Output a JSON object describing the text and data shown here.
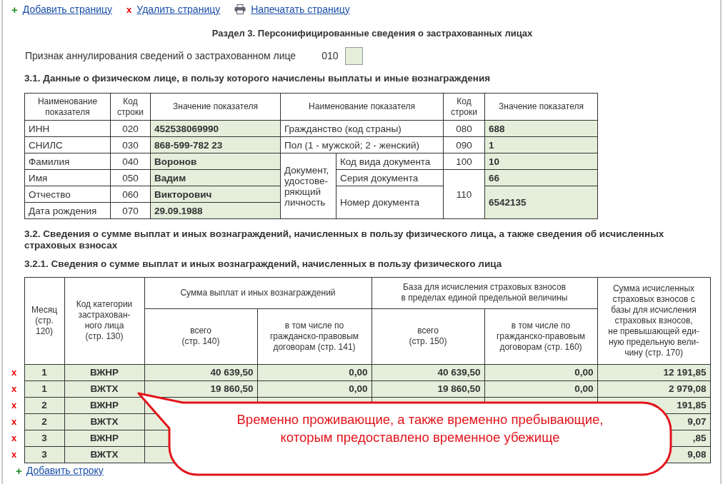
{
  "toolbar": [
    {
      "kind": "add",
      "icon": "+",
      "label": "Добавить страницу"
    },
    {
      "kind": "delete",
      "icon": "x",
      "label": "Удалить страницу"
    },
    {
      "kind": "print",
      "label": "Напечатать страницу"
    }
  ],
  "section_title": "Раздел 3. Персонифицированные сведения о застрахованных лицах",
  "cancel_flag": {
    "label": "Признак аннулирования сведений о застрахованном лице",
    "code": "010"
  },
  "subsection_1": {
    "title": "3.1. Данные о физическом лице, в пользу которого начислены выплаты и иные вознаграждения",
    "columns": [
      "Наименование\nпоказателя",
      "Код\nстроки",
      "Значение показателя",
      "Наименование показателя",
      "Код\nстроки",
      "Значение показателя"
    ],
    "left_rows": [
      {
        "name": "ИНН",
        "code": "020",
        "value": "452538069990"
      },
      {
        "name": "СНИЛС",
        "code": "030",
        "value": "868-599-782 23"
      },
      {
        "name": "Фамилия",
        "code": "040",
        "value": "Воронов"
      },
      {
        "name": "Имя",
        "code": "050",
        "value": "Вадим"
      },
      {
        "name": "Отчество",
        "code": "060",
        "value": "Викторович"
      },
      {
        "name": "Дата рождения",
        "code": "070",
        "value": "29.09.1988"
      }
    ],
    "right_rows": [
      {
        "name": "Гражданство (код страны)",
        "code": "080",
        "value": "688"
      },
      {
        "name": "Пол (1 - мужской; 2 - женский)",
        "code": "090",
        "value": "1"
      }
    ],
    "document": {
      "label": "Документ,\nудостове-\nряющий\nличность",
      "type": {
        "name": "Код вида документа",
        "code": "100",
        "value": "10"
      },
      "series": {
        "name": "Серия документа",
        "code": "110",
        "value": "66"
      },
      "number": {
        "name": "Номер документа",
        "value": "6542135"
      }
    }
  },
  "subsection_2": {
    "title": "3.2. Сведения о сумме выплат и иных вознаграждений, начисленных в пользу физического лица, а также сведения об исчисленных страховых взносах"
  },
  "subsection_2_1": {
    "title": "3.2.1. Сведения о сумме выплат и иных вознаграждений, начисленных в пользу физического лица",
    "header": {
      "month": "Месяц\n(стр.\n120)",
      "category": "Код категории\nзастрахован-\nного лица\n(стр. 130)",
      "payments": {
        "title": "Сумма выплат и иных вознаграждений",
        "sub": [
          "всего\n(стр. 140)",
          "в том числе по\nгражданско-правовым\nдоговорам (стр. 141)"
        ]
      },
      "base": {
        "title": "База для исчисления страховых взносов\nв пределах единой предельной величины",
        "sub": [
          "всего\n(стр. 150)",
          "в том числе по\nгражданско-правовым\nдоговорам (стр. 160)"
        ]
      },
      "contributions": "Сумма исчисленных\nстраховых взносов с\nбазы для исчисления\nстраховых взносов,\nне превышающей еди-\nную предельную вели-\nчину (стр. 170)"
    },
    "rows": [
      {
        "delete": "x",
        "month": "1",
        "category": "ВЖНР",
        "total_140": "40 639,50",
        "contract_141": "0,00",
        "base_150": "40 639,50",
        "base_contract_160": "0,00",
        "contributions_170": "12 191,85"
      },
      {
        "delete": "x",
        "month": "1",
        "category": "ВЖТХ",
        "total_140": "19 860,50",
        "contract_141": "0,00",
        "base_150": "19 860,50",
        "base_contract_160": "0,00",
        "contributions_170": "2 979,08"
      },
      {
        "delete": "x",
        "month": "2",
        "category": "ВЖНР",
        "contributions_170": "191,85"
      },
      {
        "delete": "x",
        "month": "2",
        "category": "ВЖТХ",
        "contributions_170": "9,07"
      },
      {
        "delete": "x",
        "month": "3",
        "category": "ВЖНР",
        "contributions_170": ",85"
      },
      {
        "delete": "x",
        "month": "3",
        "category": "ВЖТХ",
        "contributions_170": "9,08"
      }
    ],
    "add_row": {
      "icon": "+",
      "label": "Добавить строку"
    }
  },
  "callout": {
    "text": "Временно проживающие, а также временно пребывающие,\nкоторым предоставлено временное убежище"
  }
}
